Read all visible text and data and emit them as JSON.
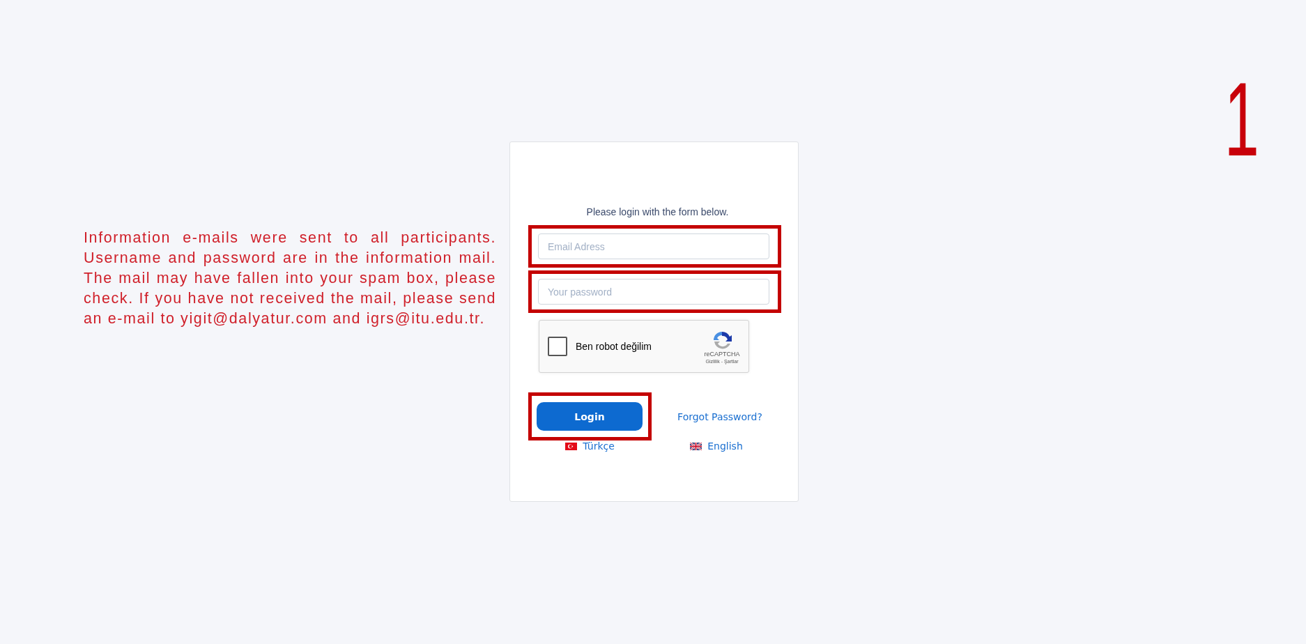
{
  "info_text": "Information e-mails were sent to all participants. Username and password are in the information mail. The mail may have fallen into your spam box, please check. If you have not received the mail, please send an e-mail to yigit@dalyatur.com and igrs@itu.edu.tr.",
  "marker": "1",
  "form": {
    "instruction": "Please login with the form below.",
    "fields": [
      {
        "placeholder": "Email Adress",
        "highlighted": true
      },
      {
        "placeholder": "Your password",
        "highlighted": true
      }
    ],
    "captcha": {
      "label": "Ben robot değilim",
      "checked": false,
      "brand": "reCAPTCHA",
      "links": "Gizlilik - Şartlar"
    },
    "login": {
      "label": "Login",
      "highlighted": true
    },
    "forgot": "Forgot Password?",
    "languages": [
      {
        "kind": "tr",
        "label": "Türkçe"
      },
      {
        "kind": "gb",
        "label": "English"
      }
    ]
  }
}
